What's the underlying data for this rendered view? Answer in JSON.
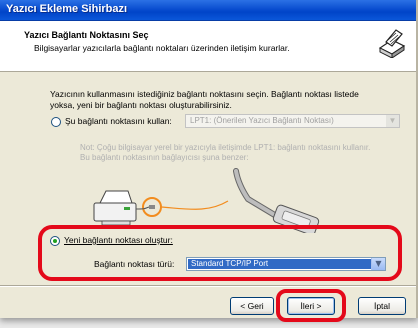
{
  "window": {
    "title": "Yazıcı Ekleme Sihirbazı"
  },
  "header": {
    "title": "Yazıcı Bağlantı Noktasını Seç",
    "subtitle": "Bilgisayarlar yazıcılarla bağlantı noktaları üzerinden iletişim kurarlar.",
    "icon": "printer-wizard-icon"
  },
  "body": {
    "description_line1": "Yazıcının kullanmasını istediğiniz bağlantı noktasını seçin. Bağlantı noktası listede",
    "description_line2": "yoksa, yeni bir bağlantı noktası oluşturabilirsiniz.",
    "option_existing": {
      "label": "Şu bağlantı noktasını kullan:",
      "selected_value": "LPT1: (Önerilen Yazıcı Bağlantı Noktası)",
      "checked": false
    },
    "note_line1": "Not: Çoğu bilgisayar yerel bir yazıcıyla iletişimde LPT1: bağlantı noktasını kullanır.",
    "note_line2": "Bu bağlantı noktasının bağlayıcısı şuna benzer:",
    "option_new": {
      "label": "Yeni bağlantı noktası oluştur:",
      "checked": true
    },
    "port_type": {
      "label": "Bağlantı noktası türü:",
      "selected_value": "Standard TCP/IP Port"
    }
  },
  "buttons": {
    "back": "< Geri",
    "next": "İleri >",
    "cancel": "İptal"
  },
  "colors": {
    "titlebar": "#0a4ed0",
    "highlight": "#e4091a",
    "selection": "#316ac5"
  }
}
